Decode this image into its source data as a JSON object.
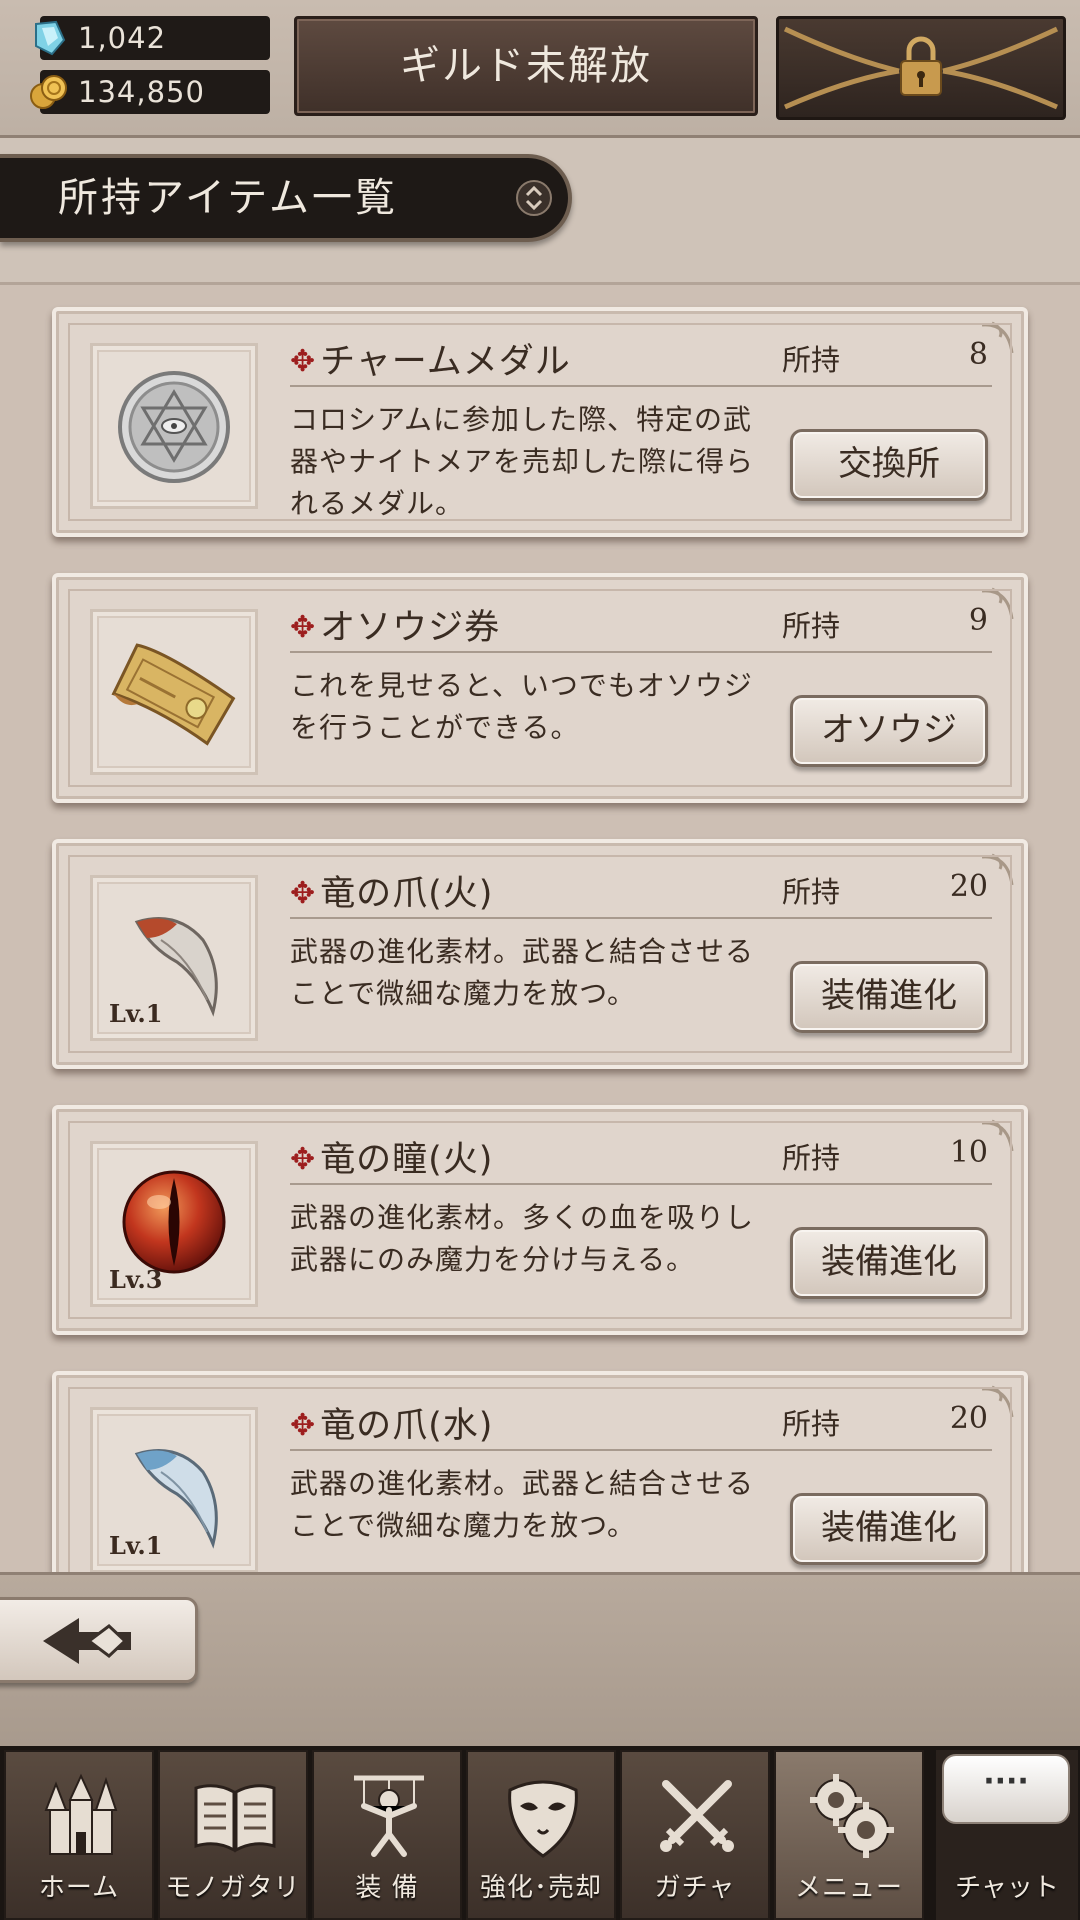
{
  "header": {
    "gems": "1,042",
    "coins": "134,850",
    "guild_label": "ギルド未解放"
  },
  "section": {
    "title": "所持アイテム一覧"
  },
  "items": [
    {
      "name": "チャームメダル",
      "own_label": "所持",
      "count": "8",
      "desc": "コロシアムに参加した際、特定の武器やナイトメアを売却した際に得られるメダル。",
      "button": "交換所",
      "level": "",
      "icon": "charm-medal-icon"
    },
    {
      "name": "オソウジ券",
      "own_label": "所持",
      "count": "9",
      "desc": "これを見せると、いつでもオソウジを行うことができる。",
      "button": "オソウジ",
      "level": "",
      "icon": "cleaning-ticket-icon"
    },
    {
      "name": "竜の爪(火)",
      "own_label": "所持",
      "count": "20",
      "desc": "武器の進化素材。武器と結合させることで微細な魔力を放つ。",
      "button": "装備進化",
      "level": "Lv.1",
      "icon": "dragon-claw-fire-icon"
    },
    {
      "name": "竜の瞳(火)",
      "own_label": "所持",
      "count": "10",
      "desc": "武器の進化素材。多くの血を吸りし武器にのみ魔力を分け与える。",
      "button": "装備進化",
      "level": "Lv.3",
      "icon": "dragon-eye-fire-icon"
    },
    {
      "name": "竜の爪(水)",
      "own_label": "所持",
      "count": "20",
      "desc": "武器の進化素材。武器と結合させることで微細な魔力を放つ。",
      "button": "装備進化",
      "level": "Lv.1",
      "icon": "dragon-claw-water-icon"
    }
  ],
  "nav": {
    "items": [
      {
        "label": "ホーム",
        "icon": "castle-icon"
      },
      {
        "label": "モノガタリ",
        "icon": "book-icon"
      },
      {
        "label": "装 備",
        "icon": "puppet-icon"
      },
      {
        "label": "強化･売却",
        "icon": "mask-icon"
      },
      {
        "label": "ガチャ",
        "icon": "swords-icon"
      },
      {
        "label": "メニュー",
        "icon": "gears-icon"
      }
    ],
    "chat_bubble": "····",
    "chat_label": "チャット"
  },
  "colors": {
    "accent_cross": "#9d1e1e",
    "panel": "#e0d5cc",
    "dark": "#1e1916"
  }
}
